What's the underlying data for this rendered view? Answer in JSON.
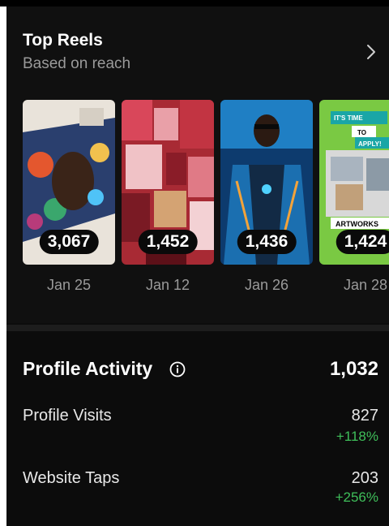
{
  "top_reels": {
    "title": "Top Reels",
    "subtitle": "Based on reach",
    "more_icon": "chevron-right-icon",
    "items": [
      {
        "count": "3,067",
        "date": "Jan 25"
      },
      {
        "count": "1,452",
        "date": "Jan 12"
      },
      {
        "count": "1,436",
        "date": "Jan 26"
      },
      {
        "count": "1,424",
        "date": "Jan 28",
        "thumb_text_1": "IT'S TIME",
        "thumb_text_2": "TO",
        "thumb_text_3": "APPLY!",
        "thumb_text_4": "ARTWORKS"
      }
    ]
  },
  "profile_activity": {
    "title": "Profile Activity",
    "info_icon": "info-icon",
    "total": "1,032",
    "metrics": [
      {
        "label": "Profile Visits",
        "value": "827",
        "change": "+118%"
      },
      {
        "label": "Website Taps",
        "value": "203",
        "change": "+256%"
      }
    ]
  },
  "colors": {
    "background": "#0c0c0c",
    "positive": "#3fbf5a",
    "muted": "#9a9a9a"
  }
}
